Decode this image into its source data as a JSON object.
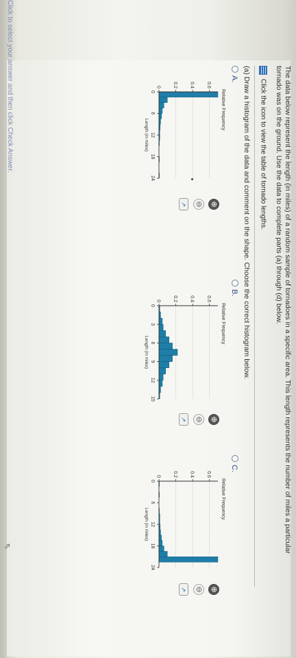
{
  "header": {
    "intro": "The data below represent the length (in miles) of a random sample of tornadoes in a specific area. This length represents the number of miles a particular tornado was on the ground. Use the data to complete parts (a) through (d) below.",
    "table_link": "Click the icon to view the table of tornado lengths."
  },
  "question": "(a) Draw a histogram of the data and comment on the shape. Choose the correct histogram below.",
  "options": [
    {
      "label": "A."
    },
    {
      "label": "B."
    },
    {
      "label": "C."
    }
  ],
  "footer": "Click to select your answer and then click Check Answer.",
  "icons": {
    "table": "table-icon",
    "zoom_in": "zoom-in-icon",
    "zoom_out": "zoom-out-icon",
    "expand": "expand-icon",
    "cursor": "pointer-icon"
  },
  "colors": {
    "bar": "#1f7ea8",
    "link": "#2a4a8a"
  },
  "chart_data": [
    {
      "type": "bar",
      "ylabel": "Relative Frequency",
      "xlabel": "Length (in miles)",
      "yticks": [
        "0",
        "0.2",
        "0.4",
        "0.6"
      ],
      "xticks": [
        "0",
        "6",
        "12",
        "18",
        "24"
      ],
      "ylim": [
        0,
        0.7
      ],
      "xlim": [
        0,
        24
      ],
      "bin_width": 1.5,
      "values": [
        0.7,
        0.1,
        0.06,
        0.04,
        0.03,
        0.02,
        0.015,
        0.01,
        0.01,
        0.005,
        0,
        0,
        0.005,
        0,
        0,
        0.005
      ]
    },
    {
      "type": "bar",
      "ylabel": "Relative Frequency",
      "xlabel": "Length (in miles)",
      "yticks": [
        "0",
        "0.2",
        "0.4",
        "0.6"
      ],
      "xticks": [
        "0",
        "3",
        "6",
        "9",
        "12",
        "15"
      ],
      "ylim": [
        0,
        0.7
      ],
      "xlim": [
        0,
        15
      ],
      "bin_width": 1,
      "values": [
        0.01,
        0.02,
        0.04,
        0.05,
        0.08,
        0.12,
        0.16,
        0.22,
        0.16,
        0.12,
        0.08,
        0.05,
        0.04,
        0.02,
        0.01
      ]
    },
    {
      "type": "bar",
      "ylabel": "Relative Frequency",
      "xlabel": "Length (in miles)",
      "yticks": [
        "0",
        "0.2",
        "0.4",
        "0.6"
      ],
      "xticks": [
        "0",
        "6",
        "12",
        "18",
        "24"
      ],
      "ylim": [
        0,
        0.7
      ],
      "xlim": [
        0,
        24
      ],
      "bin_width": 1.5,
      "values": [
        0.005,
        0,
        0.005,
        0,
        0,
        0.005,
        0.01,
        0.01,
        0.015,
        0.02,
        0.03,
        0.04,
        0.06,
        0.1,
        0.7,
        0
      ]
    }
  ]
}
